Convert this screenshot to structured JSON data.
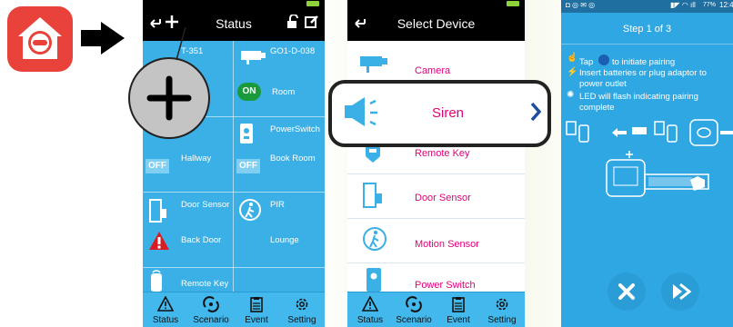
{
  "phone1": {
    "title": "Status",
    "devices": [
      {
        "name": "T-351"
      },
      {
        "name": "GO1-D-038"
      },
      {
        "name": "Room",
        "state": "ON"
      },
      {
        "name": "PowerSwitch"
      },
      {
        "name": "Hallway",
        "state": "OFF"
      },
      {
        "name": "Book Room",
        "state": "OFF"
      },
      {
        "name": "Door Sensor"
      },
      {
        "name": "PIR"
      },
      {
        "name": "Back Door"
      },
      {
        "name": "Lounge"
      },
      {
        "name": "Remote Key"
      }
    ],
    "tabs": [
      {
        "label": "Status"
      },
      {
        "label": "Scenario"
      },
      {
        "label": "Event"
      },
      {
        "label": "Setting"
      }
    ]
  },
  "phone2": {
    "title": "Select Device",
    "items": [
      {
        "label": "Camera"
      },
      {
        "label": "Siren"
      },
      {
        "label": "Remote Key"
      },
      {
        "label": "Door Sensor"
      },
      {
        "label": "Motion Sensor"
      },
      {
        "label": "Power Switch"
      }
    ],
    "tabs": [
      {
        "label": "Status"
      },
      {
        "label": "Scenario"
      },
      {
        "label": "Event"
      },
      {
        "label": "Setting"
      }
    ]
  },
  "phone3": {
    "status_time": "12:4",
    "status_battery": "77%",
    "title": "Step 1 of 3",
    "instructions": [
      {
        "text": "Tap",
        "text2": "to initiate pairing"
      },
      {
        "text": "Insert batteries or plug adaptor to power outlet"
      },
      {
        "text": "LED will flash indicating pairing complete"
      }
    ]
  },
  "colors": {
    "accent_blue": "#3ab0e6",
    "accent_pink": "#e0007a",
    "app_red": "#e8423a",
    "on_green": "#1a9a3a"
  }
}
